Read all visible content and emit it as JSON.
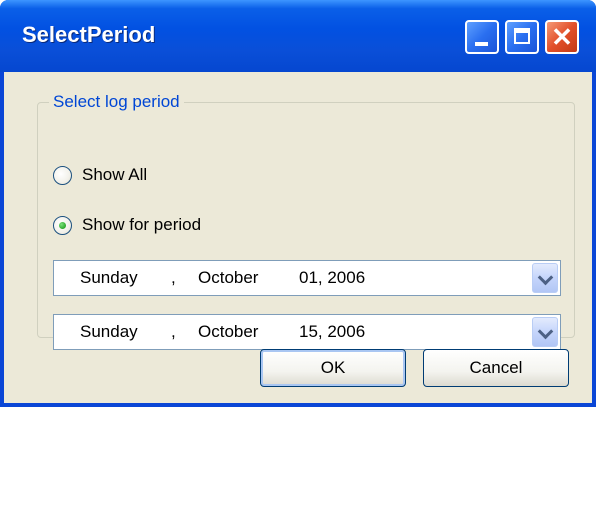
{
  "window": {
    "title": "SelectPeriod",
    "controls": {
      "minimize": "minimize-icon",
      "maximize": "maximize-icon",
      "close": "close-icon"
    }
  },
  "group": {
    "legend": "Select log period",
    "options": [
      {
        "label": "Show All",
        "checked": false
      },
      {
        "label": "Show for period",
        "checked": true
      }
    ]
  },
  "date_from": {
    "day": "Sunday",
    "separator": ",",
    "month": "October",
    "rest": "01, 2006"
  },
  "date_to": {
    "day": "Sunday",
    "separator": ",",
    "month": "October",
    "rest": "15, 2006"
  },
  "buttons": {
    "ok": "OK",
    "cancel": "Cancel"
  },
  "colors": {
    "titlebar": "#0a4fd8",
    "client": "#ece9d8",
    "legend": "#0046d5"
  }
}
